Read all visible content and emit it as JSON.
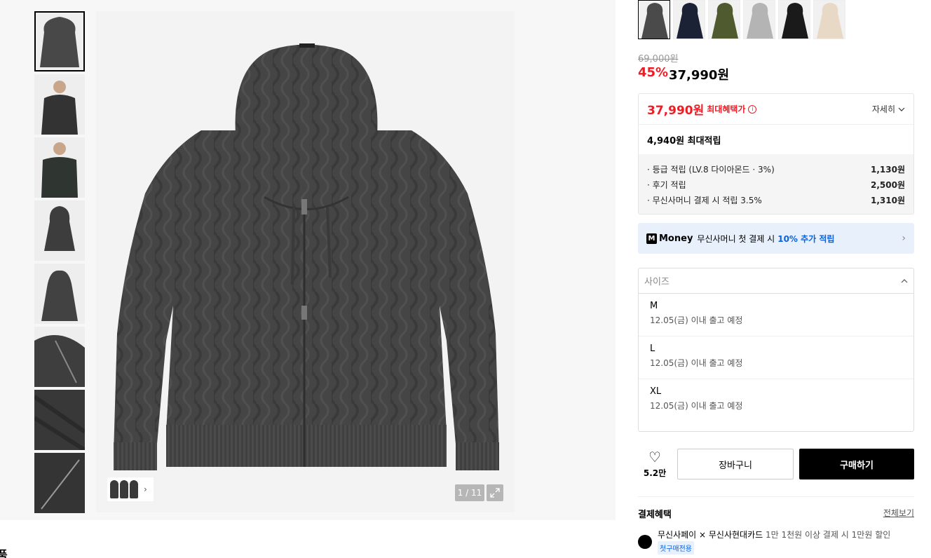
{
  "gallery": {
    "thumbnails": [
      {
        "kind": "hood-front",
        "active": true
      },
      {
        "kind": "model-1",
        "active": false
      },
      {
        "kind": "model-2",
        "active": false
      },
      {
        "kind": "hood-small",
        "active": false
      },
      {
        "kind": "hood-back",
        "active": false
      },
      {
        "kind": "detail-1",
        "active": false
      },
      {
        "kind": "detail-2",
        "active": false
      },
      {
        "kind": "detail-3",
        "active": false
      }
    ],
    "counter": "1 / 11",
    "bottom_label": "품"
  },
  "colors": {
    "swatches": [
      "#4a4a4a",
      "#1c2235",
      "#4f5a2e",
      "#b4b4b4",
      "#1a1a1a",
      "#e8d8c6"
    ],
    "selected": 0
  },
  "pricing": {
    "original": "69,000원",
    "discount": "45%",
    "sale": "37,990원"
  },
  "benefit": {
    "max_price": "37,990원",
    "max_label": "최대혜택가",
    "detail_link": "자세히",
    "points_total": "4,940원 최대적립",
    "rows": [
      {
        "label": "· 등급 적립 (LV.8 다이아몬드 · 3%)",
        "value": "1,130원"
      },
      {
        "label": "· 후기 적립",
        "value": "2,500원"
      },
      {
        "label": "· 무신사머니 결제 시 적립 3.5%",
        "value": "1,310원"
      }
    ]
  },
  "money_banner": {
    "logo": "M",
    "word": "Money",
    "text": "무신사머니 첫 결제 시",
    "highlight": "10% 추가 적립"
  },
  "size": {
    "placeholder": "사이즈",
    "options": [
      {
        "name": "M",
        "ship": "12.05(금) 이내 출고 예정"
      },
      {
        "name": "L",
        "ship": "12.05(금) 이내 출고 예정"
      },
      {
        "name": "XL",
        "ship": "12.05(금) 이내 출고 예정"
      }
    ]
  },
  "actions": {
    "like_count": "5.2만",
    "cart": "장바구니",
    "buy": "구매하기"
  },
  "payment": {
    "title": "결제혜택",
    "view_all": "전체보기",
    "card_name": "무신사페이 × 무신사현대카드",
    "card_desc": "1만 1천원 이상 결제 시 1만원 할인",
    "tag": "첫구매전용"
  }
}
